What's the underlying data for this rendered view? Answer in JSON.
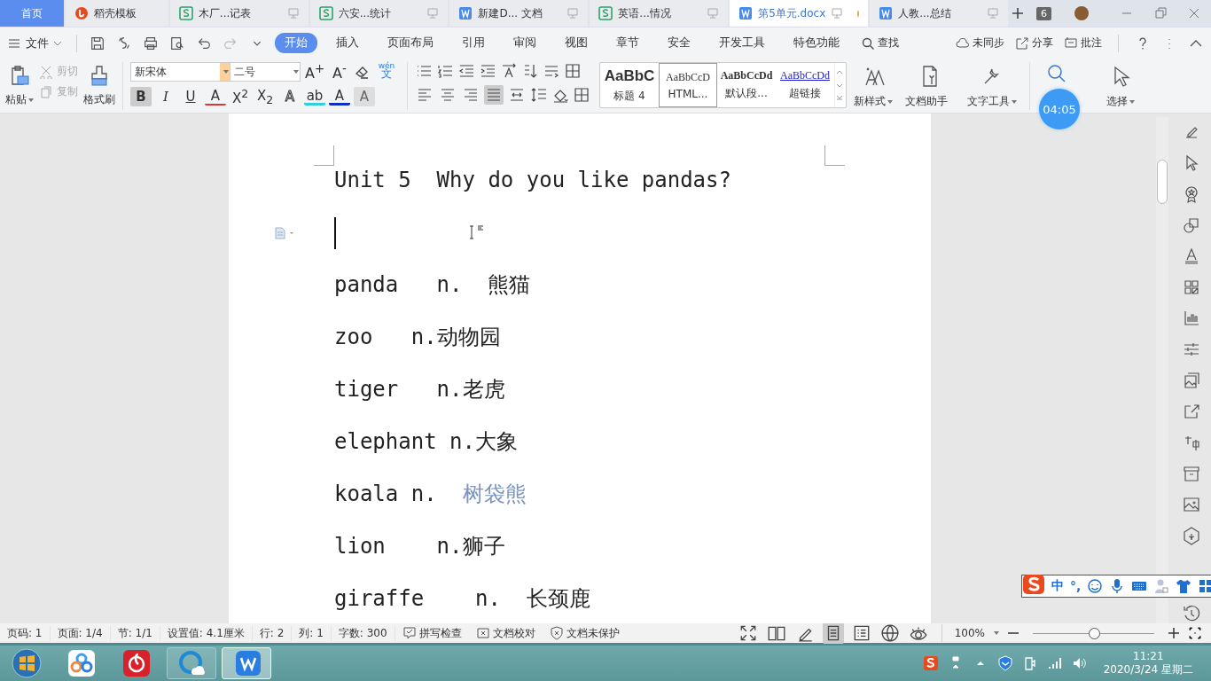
{
  "tabs": [
    {
      "label": "首页",
      "kind": "home",
      "selected": false,
      "unsaved": false
    },
    {
      "label": "稻壳模板",
      "kind": "template",
      "selected": false,
      "unsaved": false
    },
    {
      "label": "木厂...记表",
      "kind": "sheet",
      "selected": false,
      "unsaved": false
    },
    {
      "label": "六安...统计",
      "kind": "sheet",
      "selected": false,
      "unsaved": false
    },
    {
      "label": "新建D... 文档",
      "kind": "doc",
      "selected": false,
      "unsaved": false
    },
    {
      "label": "英语...情况",
      "kind": "sheet",
      "selected": false,
      "unsaved": false
    },
    {
      "label": "第5单元.docx",
      "kind": "doc",
      "selected": true,
      "unsaved": true
    },
    {
      "label": "人教...总结",
      "kind": "doc",
      "selected": false,
      "unsaved": false
    }
  ],
  "tab_count": "6",
  "menu": {
    "file": "文件",
    "items": [
      {
        "label": "开始",
        "selected": true
      },
      {
        "label": "插入",
        "selected": false
      },
      {
        "label": "页面布局",
        "selected": false
      },
      {
        "label": "引用",
        "selected": false
      },
      {
        "label": "审阅",
        "selected": false
      },
      {
        "label": "视图",
        "selected": false
      },
      {
        "label": "章节",
        "selected": false
      },
      {
        "label": "安全",
        "selected": false
      },
      {
        "label": "开发工具",
        "selected": false
      },
      {
        "label": "特色功能",
        "selected": false
      }
    ],
    "search": "查找",
    "sync": "未同步",
    "share": "分享",
    "comment": "批注"
  },
  "ribbon": {
    "paste": "粘贴",
    "cut": {
      "label": "剪切",
      "disabled": true
    },
    "copy": {
      "label": "复制",
      "disabled": true
    },
    "painter": "格式刷",
    "font_name": "新宋体",
    "font_size": "二号",
    "size_tools": [
      {
        "label": "A$^{+}$"
      },
      {
        "label": "A$^{-}$"
      }
    ],
    "pinyin": {
      "ruby": "wén",
      "base": "文"
    },
    "format_buttons": [
      {
        "label": "B",
        "kind": "bold",
        "on": true
      },
      {
        "label": "I",
        "kind": "italic",
        "on": false
      },
      {
        "label": "U",
        "kind": "underline",
        "on": false
      },
      {
        "label": "A",
        "kind": "strike",
        "on": false
      },
      {
        "label": "X$^{2}$",
        "kind": "sup",
        "on": false
      },
      {
        "label": "X$_{2}$",
        "kind": "sub",
        "on": false
      },
      {
        "label": "A",
        "kind": "effect",
        "on": false
      },
      {
        "label": "ab",
        "kind": "highlight",
        "on": false
      },
      {
        "label": "A",
        "kind": "color",
        "on": false
      },
      {
        "label": "A",
        "kind": "shade",
        "on": false
      }
    ],
    "align_buttons": [
      {
        "selected": false
      },
      {
        "selected": false
      },
      {
        "selected": false
      },
      {
        "selected": true
      },
      {
        "selected": false
      }
    ],
    "styles": [
      {
        "preview": "AaBbC",
        "label": "标题 4",
        "kind": "heading",
        "selected": false
      },
      {
        "preview": "AaBbCcD",
        "label": "HTML...",
        "kind": "mono",
        "selected": true
      },
      {
        "preview": "AaBbCcDd",
        "label": "默认段...",
        "kind": "normal",
        "selected": false
      },
      {
        "preview": "AaBbCcDd",
        "label": "超链接",
        "kind": "link",
        "selected": false
      }
    ],
    "tools": [
      {
        "label": "新样式",
        "dropdown": true
      },
      {
        "label": "文档助手",
        "dropdown": false
      },
      {
        "label": "文字工具",
        "dropdown": true
      }
    ],
    "select": "选择",
    "timer": "04:05"
  },
  "document": {
    "title": "Unit 5  Why do you like pandas?",
    "lines": [
      {
        "term": "panda   n.  ",
        "meaning": "熊猫",
        "highlighted": false
      },
      {
        "term": "zoo   n.",
        "meaning": "动物园",
        "highlighted": false
      },
      {
        "term": "tiger   n.",
        "meaning": "老虎",
        "highlighted": false
      },
      {
        "term": "elephant n.",
        "meaning": "大象",
        "highlighted": false
      },
      {
        "term": "koala n.  ",
        "meaning": "树袋熊",
        "highlighted": true
      },
      {
        "term": "lion    n.",
        "meaning": "狮子",
        "highlighted": false
      },
      {
        "term": "giraffe    n.  ",
        "meaning": "长颈鹿",
        "highlighted": false
      }
    ]
  },
  "ime": {
    "mode": "中",
    "punct": "°,"
  },
  "status_bar": {
    "items": [
      "页码: 1",
      "页面: 1/4",
      "节: 1/1",
      "设置值: 4.1厘米",
      "行: 2",
      "列: 1",
      "字数: 300"
    ],
    "tools": [
      "拼写检查",
      "文档校对",
      "文档未保护"
    ],
    "view_buttons": [
      {
        "selected": false
      },
      {
        "selected": false
      },
      {
        "selected": false
      },
      {
        "selected": true
      },
      {
        "selected": false
      },
      {
        "selected": false
      },
      {
        "selected": false
      }
    ],
    "zoom": "100%",
    "zoom_slider": {
      "level": 0.5
    }
  },
  "taskbar": {
    "apps": [
      {
        "kind": "cloud",
        "selected": false,
        "running": false
      },
      {
        "kind": "music",
        "selected": false,
        "running": false
      },
      {
        "kind": "browser",
        "selected": false,
        "running": true
      },
      {
        "kind": "office",
        "selected": true,
        "running": true
      }
    ],
    "time": "11:21",
    "date": "2020/3/24 星期二"
  }
}
